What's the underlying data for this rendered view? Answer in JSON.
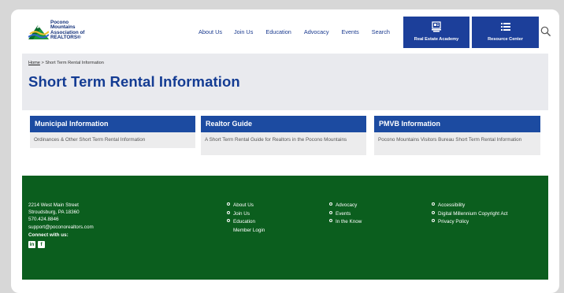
{
  "header": {
    "logo_text": [
      "Pocono",
      "Mountains",
      "Association of",
      "REALTORS®"
    ],
    "nav": [
      "About Us",
      "Join Us",
      "Education",
      "Advocacy",
      "Events",
      "Search"
    ],
    "tiles": [
      {
        "label": "Real Estate Academy",
        "icon": "academy-icon"
      },
      {
        "label": "Resource Center",
        "icon": "list-icon"
      }
    ],
    "search_icon": "search-icon"
  },
  "breadcrumb": {
    "home": "Home",
    "separator": ">",
    "current": "Short Term Rental Information"
  },
  "page_title": "Short Term Rental Information",
  "cards": [
    {
      "title": "Municipal Information",
      "body": "Ordinances & Other Short Term Rental Information"
    },
    {
      "title": "Realtor Guide",
      "body": "A Short Term Rental Guide for Realtors in the Pocono Mountains"
    },
    {
      "title": "PMVB Information",
      "body": "Pocono Mountains Visitors Bureau Short Term Rental Information"
    }
  ],
  "footer": {
    "address": [
      "2214 West Main Street",
      "Stroudsburg, PA 18360",
      "570.424.8846",
      "support@poconorealtors.com"
    ],
    "connect_label": "Connect with us:",
    "social": [
      {
        "icon": "linkedin-icon",
        "glyph": "in"
      },
      {
        "icon": "facebook-icon",
        "glyph": "f"
      }
    ],
    "col1": [
      "About Us",
      "Join Us",
      "Education"
    ],
    "col1_extra": "Member Login",
    "col2": [
      "Advocacy",
      "Events",
      "In the Know"
    ],
    "col3": [
      "Accessibility",
      "Digital Millennium Copyright Act",
      "Privacy Policy"
    ]
  },
  "colors": {
    "brand_blue": "#1c3f9a",
    "title_blue": "#143c93",
    "footer_green": "#0b5e1e",
    "hero_gray": "#e9eaee"
  }
}
